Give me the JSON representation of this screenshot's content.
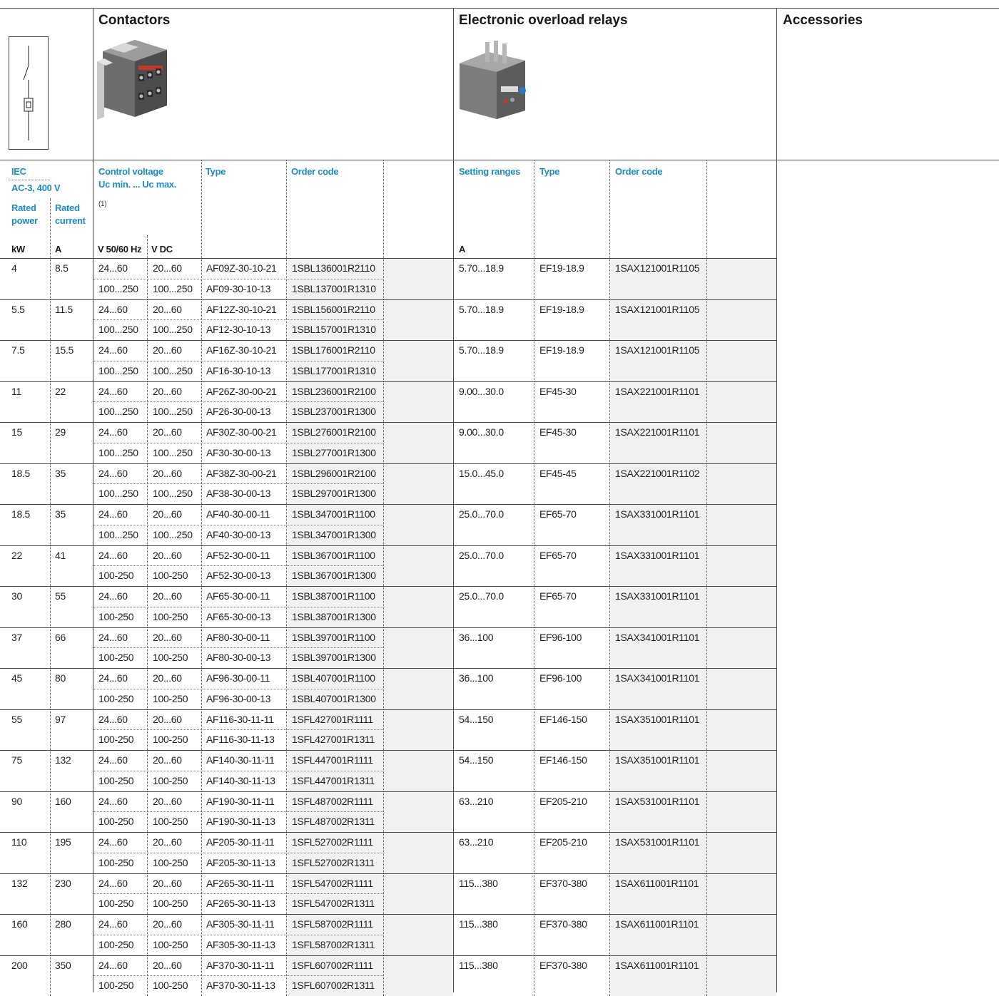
{
  "sections": {
    "contactors": "Contactors",
    "overload": "Electronic overload relays",
    "accessories": "Accessories"
  },
  "headers": {
    "iec": "IEC",
    "ac3": "AC-3, 400 V",
    "rated_power": "Rated power",
    "rated_current": "Rated current",
    "unit_kw": "kW",
    "unit_a": "A",
    "control_voltage": "Control voltage",
    "uc_range": "Uc min. ... Uc max.",
    "footnote": "(1)",
    "v_ac": "V 50/60 Hz",
    "v_dc": "V DC",
    "type": "Type",
    "order_code": "Order code",
    "setting_ranges": "Setting ranges",
    "setting_unit": "A",
    "relay_type": "Type",
    "relay_order_code": "Order code"
  },
  "rows": [
    {
      "kw": "4",
      "a": "8.5",
      "ac1": "24...60",
      "dc1": "20...60",
      "t1": "AF09Z-30-10-21",
      "c1": "1SBL136001R2110",
      "ac2": "100...250",
      "dc2": "100...250",
      "t2": "AF09-30-10-13",
      "c2": "1SBL137001R1310",
      "range": "5.70...18.9",
      "rtype": "EF19-18.9",
      "rcode": "1SAX121001R1105"
    },
    {
      "kw": "5.5",
      "a": "11.5",
      "ac1": "24...60",
      "dc1": "20...60",
      "t1": "AF12Z-30-10-21",
      "c1": "1SBL156001R2110",
      "ac2": "100...250",
      "dc2": "100...250",
      "t2": "AF12-30-10-13",
      "c2": "1SBL157001R1310",
      "range": "5.70...18.9",
      "rtype": "EF19-18.9",
      "rcode": "1SAX121001R1105"
    },
    {
      "kw": "7.5",
      "a": "15.5",
      "ac1": "24...60",
      "dc1": "20...60",
      "t1": "AF16Z-30-10-21",
      "c1": "1SBL176001R2110",
      "ac2": "100...250",
      "dc2": "100...250",
      "t2": "AF16-30-10-13",
      "c2": "1SBL177001R1310",
      "range": "5.70...18.9",
      "rtype": "EF19-18.9",
      "rcode": "1SAX121001R1105"
    },
    {
      "kw": "11",
      "a": "22",
      "ac1": "24...60",
      "dc1": "20...60",
      "t1": "AF26Z-30-00-21",
      "c1": "1SBL236001R2100",
      "ac2": "100...250",
      "dc2": "100...250",
      "t2": "AF26-30-00-13",
      "c2": "1SBL237001R1300",
      "range": "9.00...30.0",
      "rtype": "EF45-30",
      "rcode": "1SAX221001R1101"
    },
    {
      "kw": "15",
      "a": "29",
      "ac1": "24...60",
      "dc1": "20...60",
      "t1": "AF30Z-30-00-21",
      "c1": "1SBL276001R2100",
      "ac2": "100...250",
      "dc2": "100...250",
      "t2": "AF30-30-00-13",
      "c2": "1SBL277001R1300",
      "range": "9.00...30.0",
      "rtype": "EF45-30",
      "rcode": "1SAX221001R1101"
    },
    {
      "kw": "18.5",
      "a": "35",
      "ac1": "24...60",
      "dc1": "20...60",
      "t1": "AF38Z-30-00-21",
      "c1": "1SBL296001R2100",
      "ac2": "100...250",
      "dc2": "100...250",
      "t2": "AF38-30-00-13",
      "c2": "1SBL297001R1300",
      "range": "15.0...45.0",
      "rtype": "EF45-45",
      "rcode": "1SAX221001R1102"
    },
    {
      "kw": "18.5",
      "a": "35",
      "ac1": "24...60",
      "dc1": "20...60",
      "t1": "AF40-30-00-11",
      "c1": "1SBL347001R1100",
      "ac2": "100...250",
      "dc2": "100...250",
      "t2": "AF40-30-00-13",
      "c2": "1SBL347001R1300",
      "range": "25.0...70.0",
      "rtype": "EF65-70",
      "rcode": "1SAX331001R1101"
    },
    {
      "kw": "22",
      "a": "41",
      "ac1": "24...60",
      "dc1": "20...60",
      "t1": "AF52-30-00-11",
      "c1": "1SBL367001R1100",
      "ac2": "100-250",
      "dc2": "100-250",
      "t2": "AF52-30-00-13",
      "c2": "1SBL367001R1300",
      "range": "25.0...70.0",
      "rtype": "EF65-70",
      "rcode": "1SAX331001R1101"
    },
    {
      "kw": "30",
      "a": "55",
      "ac1": "24...60",
      "dc1": "20...60",
      "t1": "AF65-30-00-11",
      "c1": "1SBL387001R1100",
      "ac2": "100-250",
      "dc2": "100-250",
      "t2": "AF65-30-00-13",
      "c2": "1SBL387001R1300",
      "range": "25.0...70.0",
      "rtype": "EF65-70",
      "rcode": "1SAX331001R1101"
    },
    {
      "kw": "37",
      "a": "66",
      "ac1": "24...60",
      "dc1": "20...60",
      "t1": "AF80-30-00-11",
      "c1": "1SBL397001R1100",
      "ac2": "100-250",
      "dc2": "100-250",
      "t2": "AF80-30-00-13",
      "c2": "1SBL397001R1300",
      "range": "36...100",
      "rtype": "EF96-100",
      "rcode": "1SAX341001R1101"
    },
    {
      "kw": "45",
      "a": "80",
      "ac1": "24...60",
      "dc1": "20...60",
      "t1": "AF96-30-00-11",
      "c1": "1SBL407001R1100",
      "ac2": "100-250",
      "dc2": "100-250",
      "t2": "AF96-30-00-13",
      "c2": "1SBL407001R1300",
      "range": "36...100",
      "rtype": "EF96-100",
      "rcode": "1SAX341001R1101"
    },
    {
      "kw": "55",
      "a": "97",
      "ac1": "24...60",
      "dc1": "20...60",
      "t1": "AF116-30-11-11",
      "c1": "1SFL427001R1111",
      "ac2": "100-250",
      "dc2": "100-250",
      "t2": "AF116-30-11-13",
      "c2": "1SFL427001R1311",
      "range": "54...150",
      "rtype": "EF146-150",
      "rcode": "1SAX351001R1101"
    },
    {
      "kw": "75",
      "a": "132",
      "ac1": "24...60",
      "dc1": "20...60",
      "t1": "AF140-30-11-11",
      "c1": "1SFL447001R1111",
      "ac2": "100-250",
      "dc2": "100-250",
      "t2": "AF140-30-11-13",
      "c2": "1SFL447001R1311",
      "range": "54...150",
      "rtype": "EF146-150",
      "rcode": "1SAX351001R1101"
    },
    {
      "kw": "90",
      "a": "160",
      "ac1": "24...60",
      "dc1": "20...60",
      "t1": "AF190-30-11-11",
      "c1": "1SFL487002R1111",
      "ac2": "100-250",
      "dc2": "100-250",
      "t2": "AF190-30-11-13",
      "c2": "1SFL487002R1311",
      "range": "63...210",
      "rtype": "EF205-210",
      "rcode": "1SAX531001R1101"
    },
    {
      "kw": "110",
      "a": "195",
      "ac1": "24...60",
      "dc1": "20...60",
      "t1": "AF205-30-11-11",
      "c1": "1SFL527002R1111",
      "ac2": "100-250",
      "dc2": "100-250",
      "t2": "AF205-30-11-13",
      "c2": "1SFL527002R1311",
      "range": "63...210",
      "rtype": "EF205-210",
      "rcode": "1SAX531001R1101"
    },
    {
      "kw": "132",
      "a": "230",
      "ac1": "24...60",
      "dc1": "20...60",
      "t1": "AF265-30-11-11",
      "c1": "1SFL547002R1111",
      "ac2": "100-250",
      "dc2": "100-250",
      "t2": "AF265-30-11-13",
      "c2": "1SFL547002R1311",
      "range": "115...380",
      "rtype": "EF370-380",
      "rcode": "1SAX611001R1101"
    },
    {
      "kw": "160",
      "a": "280",
      "ac1": "24...60",
      "dc1": "20...60",
      "t1": "AF305-30-11-11",
      "c1": "1SFL587002R1111",
      "ac2": "100-250",
      "dc2": "100-250",
      "t2": "AF305-30-11-13",
      "c2": "1SFL587002R1311",
      "range": "115...380",
      "rtype": "EF370-380",
      "rcode": "1SAX611001R1101"
    },
    {
      "kw": "200",
      "a": "350",
      "ac1": "24...60",
      "dc1": "20...60",
      "t1": "AF370-30-11-11",
      "c1": "1SFL607002R1111",
      "ac2": "100-250",
      "dc2": "100-250",
      "t2": "AF370-30-11-13",
      "c2": "1SFL607002R1311",
      "range": "115...380",
      "rtype": "EF370-380",
      "rcode": "1SAX611001R1101"
    }
  ]
}
